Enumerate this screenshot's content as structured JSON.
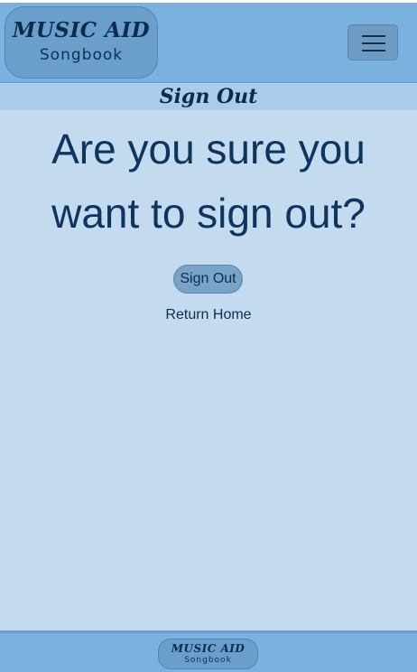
{
  "header": {
    "brand_title": "MUSIC AID",
    "brand_subtitle": "Songbook",
    "menu_icon": "hamburger-icon"
  },
  "page_title": "Sign Out",
  "main": {
    "question_line1": "Are you sure you",
    "question_line2": "want to sign out?",
    "signout_label": "Sign Out",
    "return_label": "Return Home"
  },
  "footer": {
    "brand_title": "MUSIC AID",
    "brand_subtitle": "Songbook"
  },
  "colors": {
    "header_bg": "#7ab1df",
    "page_bg": "#c4dbef",
    "title_band_bg": "#a9cdea",
    "text_dark": "#0d3560"
  }
}
